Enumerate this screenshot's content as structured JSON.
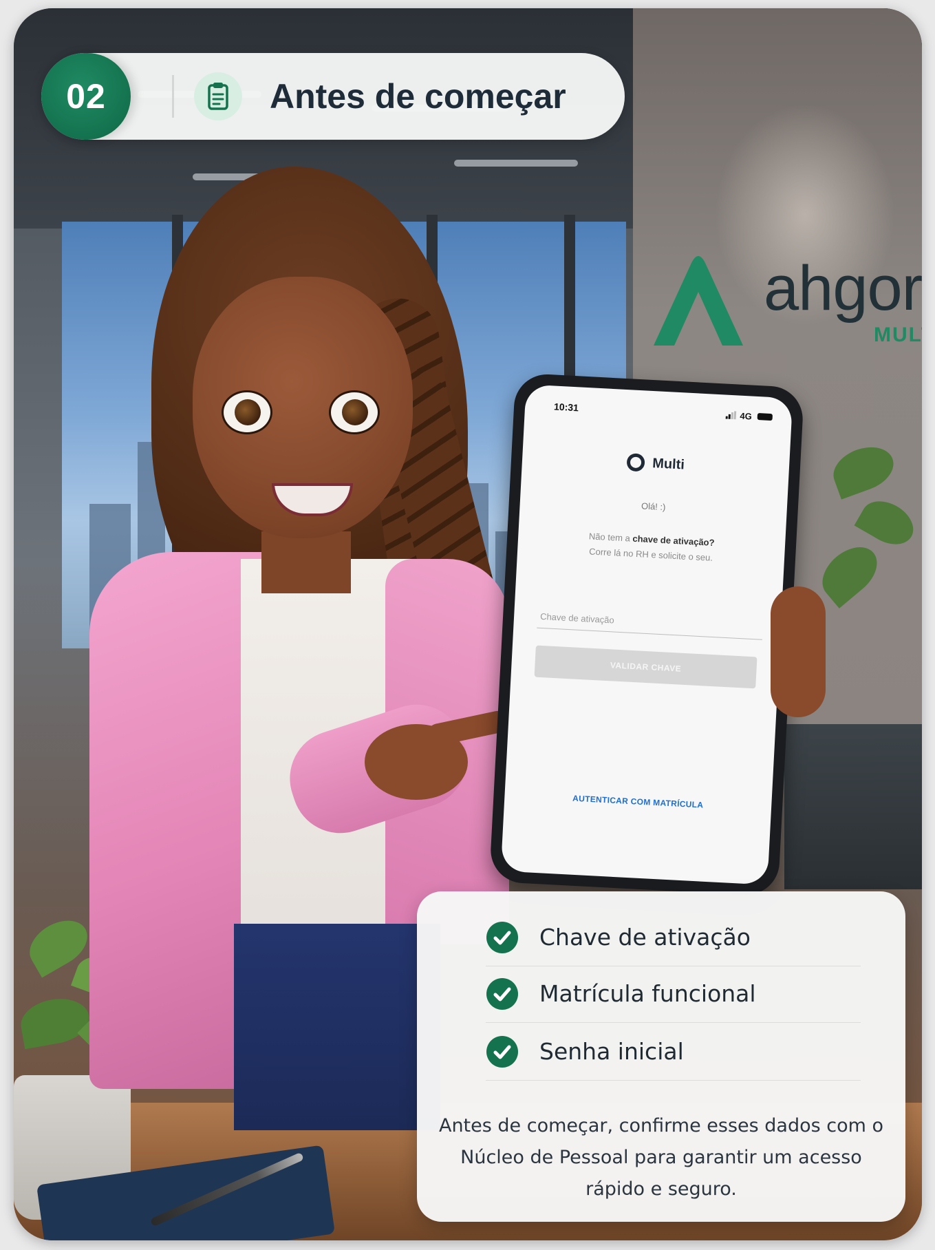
{
  "header": {
    "step_number": "02",
    "icon": "clipboard-icon",
    "title": "Antes de começar"
  },
  "background": {
    "logo_word": "ahgora",
    "logo_sub": "MULTI"
  },
  "phone": {
    "status_time": "10:31",
    "status_network": "4G",
    "app_name": "Multi",
    "greeting": "Olá! :)",
    "message_prefix": "Não tem a ",
    "message_strong": "chave de ativação?",
    "message_line2": "Corre lá no RH e solicite o seu.",
    "input_placeholder": "Chave de ativação",
    "validate_button": "VALIDAR CHAVE",
    "auth_link": "AUTENTICAR COM MATRÍCULA"
  },
  "checklist": {
    "items": [
      {
        "label": "Chave de ativação",
        "icon": "check-circle-icon"
      },
      {
        "label": "Matrícula funcional",
        "icon": "check-circle-icon"
      },
      {
        "label": "Senha inicial",
        "icon": "check-circle-icon"
      }
    ],
    "note": "Antes de começar, confirme esses dados com o Núcleo de Pessoal para garantir um acesso rápido e seguro."
  },
  "colors": {
    "brand_green": "#14724f",
    "title_text": "#1e2b38",
    "link_blue": "#1f6fd1"
  }
}
